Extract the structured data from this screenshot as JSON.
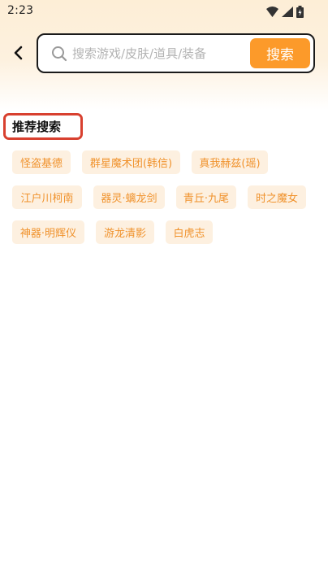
{
  "status_bar": {
    "time": "2:23",
    "icons": [
      "wifi-icon",
      "signal-icon",
      "battery-icon"
    ]
  },
  "header": {
    "back_icon": "chevron-left-icon",
    "search": {
      "placeholder": "搜索游戏/皮肤/道具/装备",
      "value": "",
      "button_label": "搜索"
    }
  },
  "recommended": {
    "title": "推荐搜索",
    "tags": [
      "怪盗基德",
      "群星魔术团(韩信)",
      "真我赫兹(瑶)",
      "江户川柯南",
      "器灵·螭龙剑",
      "青丘·九尾",
      "时之魔女",
      "神器·明辉仪",
      "游龙清影",
      "白虎志"
    ]
  },
  "colors": {
    "accent": "#fc9a2a",
    "tag_background": "#fdf0e0",
    "tag_text": "#f0922c",
    "highlight_border": "#d8402f"
  }
}
